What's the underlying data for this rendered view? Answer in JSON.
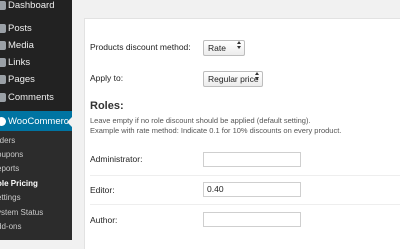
{
  "sidebar": {
    "items": [
      {
        "label": "Dashboard"
      },
      {
        "label": "Posts"
      },
      {
        "label": "Media"
      },
      {
        "label": "Links"
      },
      {
        "label": "Pages"
      },
      {
        "label": "Comments"
      },
      {
        "label": "WooCommerce"
      }
    ],
    "submenu": [
      {
        "label": "rders"
      },
      {
        "label": "oupons"
      },
      {
        "label": "eports"
      },
      {
        "label": "ole Pricing"
      },
      {
        "label": "ettings"
      },
      {
        "label": "ystem Status"
      },
      {
        "label": "dd-ons"
      }
    ],
    "active_item": "WooCommerce",
    "current_subitem": "ole Pricing",
    "accent_color": "#0074a2"
  },
  "settings": {
    "method_label": "Products discount method:",
    "method_value": "Rate",
    "apply_label": "Apply to:",
    "apply_value": "Regular price",
    "roles_heading": "Roles:",
    "help_line1": "Leave empty if no role discount should be applied (default setting).",
    "help_line2": "Example with rate method: Indicate 0.1 for 10% discounts on every product.",
    "roles": [
      {
        "label": "Administrator:",
        "value": ""
      },
      {
        "label": "Editor:",
        "value": "0.40"
      },
      {
        "label": "Author:",
        "value": ""
      }
    ]
  }
}
